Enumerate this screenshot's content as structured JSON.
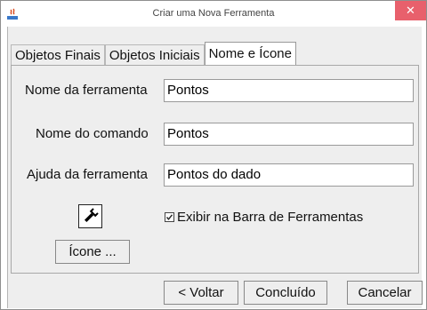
{
  "window": {
    "title": "Criar uma Nova Ferramenta",
    "close_label": "✕"
  },
  "tabs": [
    {
      "label": "Objetos Finais"
    },
    {
      "label": "Objetos Iniciais"
    },
    {
      "label": "Nome e Ícone"
    }
  ],
  "active_tab": 2,
  "form": {
    "tool_name_label": "Nome da ferramenta",
    "tool_name_value": "Pontos",
    "command_name_label": "Nome do comando",
    "command_name_value": "Pontos",
    "tool_help_label": "Ajuda da ferramenta",
    "tool_help_value": "Pontos do dado",
    "show_in_toolbar_label": "Exibir na Barra de Ferramentas",
    "show_in_toolbar_checked": true,
    "icon_button_label": "Ícone ...",
    "icon": "wrench-icon"
  },
  "footer": {
    "back_label": "< Voltar",
    "finish_label": "Concluído",
    "cancel_label": "Cancelar"
  },
  "colors": {
    "close_button": "#e8606c",
    "dialog_background": "#eeeeee"
  }
}
